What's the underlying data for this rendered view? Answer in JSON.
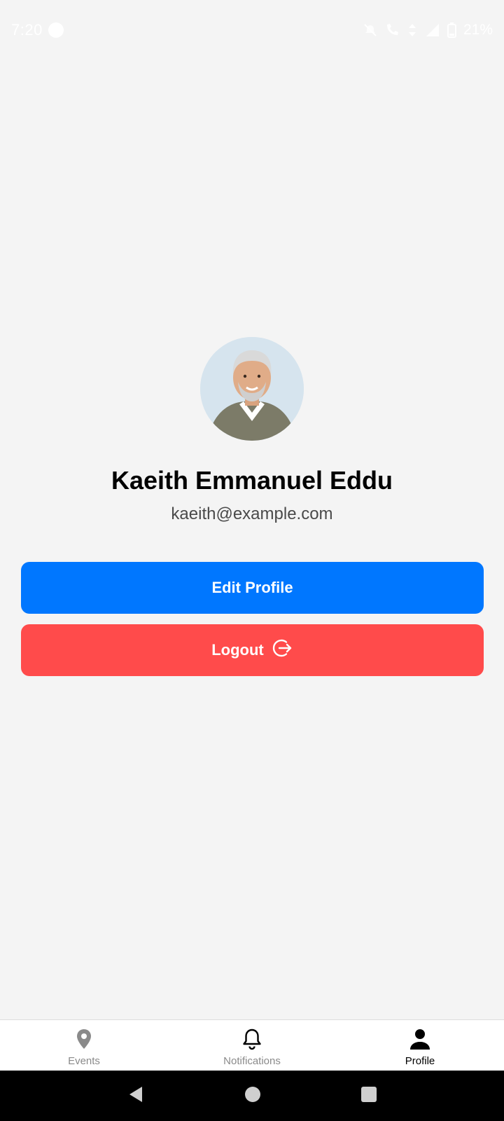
{
  "status_bar": {
    "time": "7:20",
    "battery_percent": "21%"
  },
  "profile": {
    "name": "Kaeith Emmanuel Eddu",
    "email": "kaeith@example.com",
    "avatar_icon": "user-photo"
  },
  "actions": {
    "edit_label": "Edit Profile",
    "logout_label": "Logout"
  },
  "bottom_nav": {
    "items": [
      {
        "label": "Events",
        "icon": "map-pin-icon",
        "active": false
      },
      {
        "label": "Notifications",
        "icon": "bell-icon",
        "active": false
      },
      {
        "label": "Profile",
        "icon": "person-icon",
        "active": true
      }
    ]
  },
  "colors": {
    "primary": "#0077ff",
    "danger": "#ff4b4b",
    "background": "#f4f4f4"
  }
}
